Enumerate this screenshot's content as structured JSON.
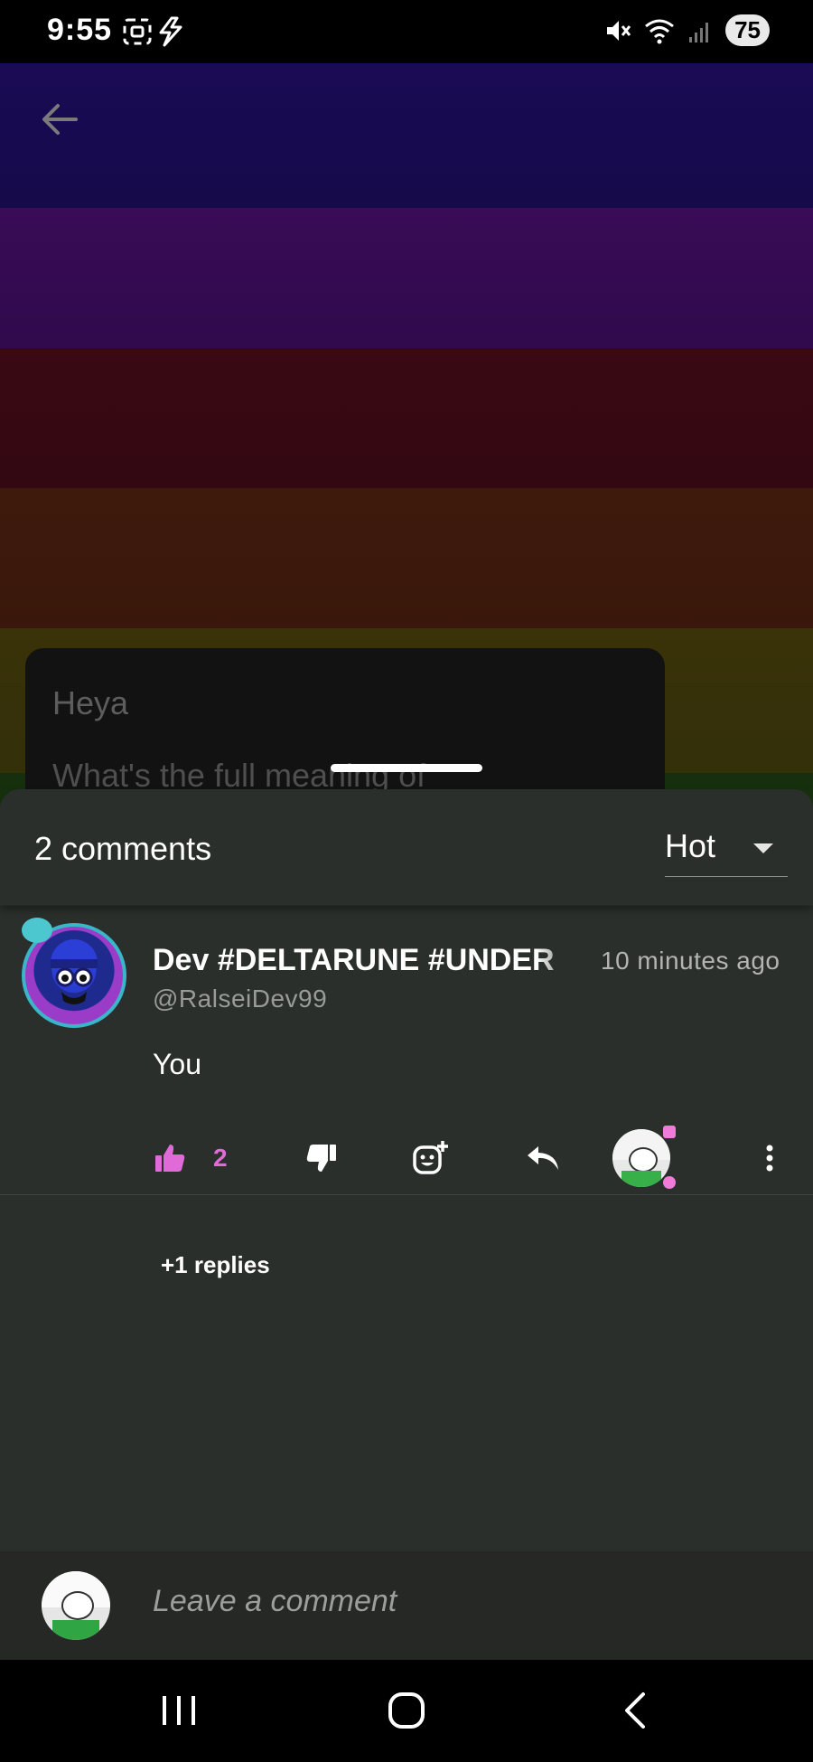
{
  "status_bar": {
    "time": "9:55",
    "battery": "75",
    "icons": [
      "screenshot-icon",
      "charging-bolt-icon",
      "mute-icon",
      "wifi-icon",
      "signal-icon"
    ]
  },
  "post": {
    "line1": "Heya",
    "line2": "What's the full meaning of"
  },
  "comments_sheet": {
    "count_label": "2 comments",
    "sort": {
      "selected": "Hot"
    }
  },
  "comment": {
    "author": "Dev #DELTARUNE #UNDER",
    "handle": "@RalseiDev99",
    "timestamp": "10 minutes ago",
    "body": "You",
    "likes": "2",
    "replies_label": "+1 replies"
  },
  "compose": {
    "placeholder": "Leave a comment"
  },
  "colors": {
    "accent_pink": "#e06bd8",
    "sheet_bg": "#2a2f2b"
  }
}
